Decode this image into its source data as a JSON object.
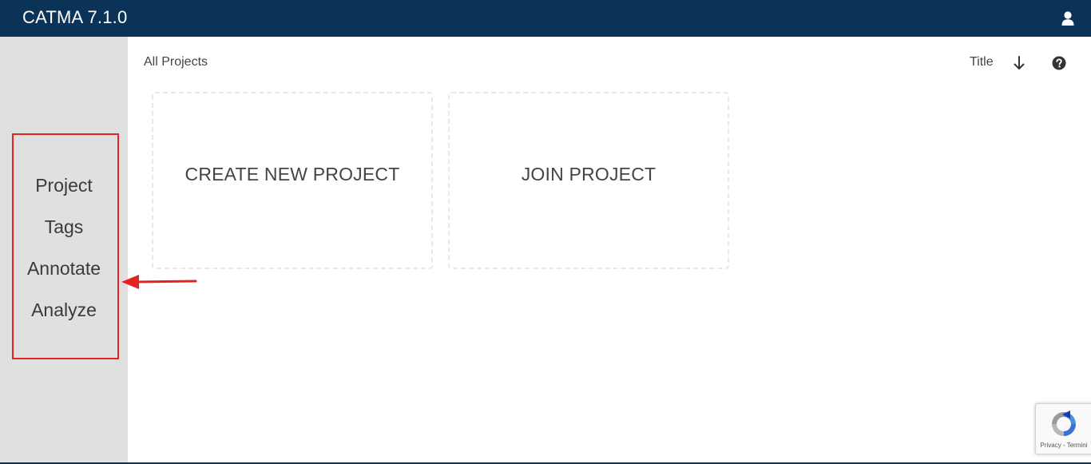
{
  "app": {
    "title": "CATMA 7.1.0"
  },
  "header": {
    "user_icon": "user-icon"
  },
  "sidebar": {
    "items": [
      {
        "label": "Project"
      },
      {
        "label": "Tags"
      },
      {
        "label": "Annotate"
      },
      {
        "label": "Analyze"
      }
    ]
  },
  "main": {
    "breadcrumb": "All Projects",
    "sort": {
      "label": "Title",
      "direction_icon": "arrow-down-icon"
    },
    "help_icon": "question-circle-icon",
    "cards": [
      {
        "label": "CREATE NEW PROJECT"
      },
      {
        "label": "JOIN PROJECT"
      }
    ]
  },
  "annotations": {
    "highlight_color": "#e52222"
  },
  "recaptcha": {
    "text": "Privacy - Termini"
  },
  "colors": {
    "topbar": "#0b3357",
    "sidebar": "#e0e0e0"
  }
}
